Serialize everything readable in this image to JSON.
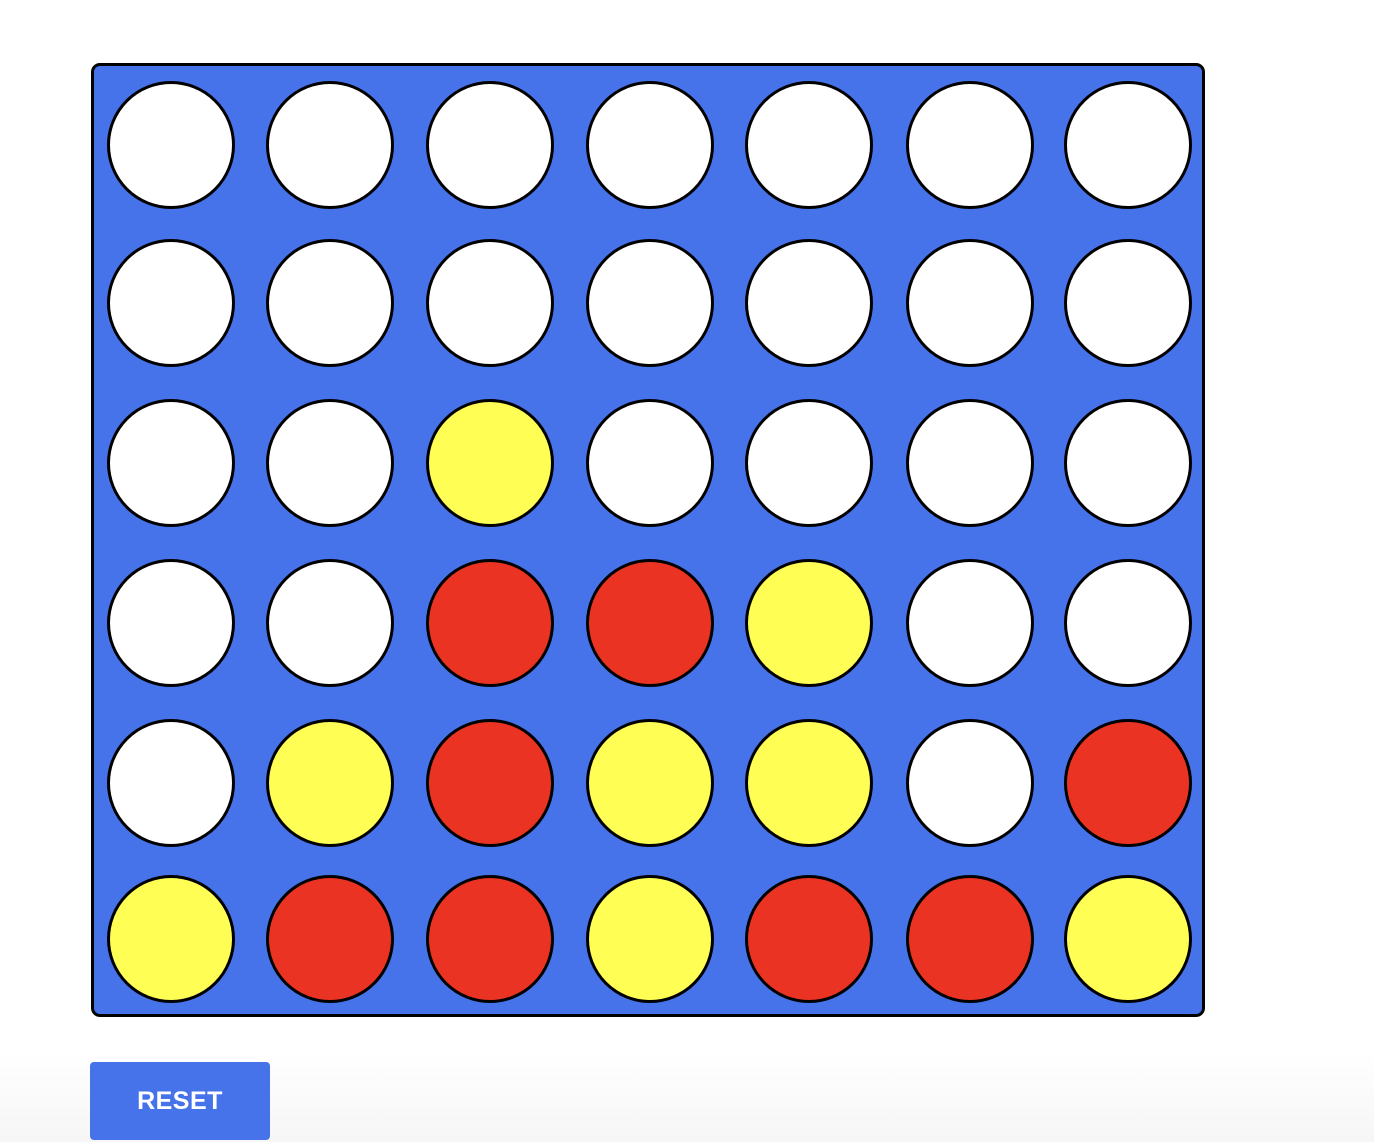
{
  "colors": {
    "board": "#4673ea",
    "empty": "#ffffff",
    "red": "#ea3323",
    "yellow": "#fefe54",
    "outline": "#000000"
  },
  "board": {
    "rows": 6,
    "cols": 7,
    "cells": [
      [
        "empty",
        "empty",
        "empty",
        "empty",
        "empty",
        "empty",
        "empty"
      ],
      [
        "empty",
        "empty",
        "empty",
        "empty",
        "empty",
        "empty",
        "empty"
      ],
      [
        "empty",
        "empty",
        "yellow",
        "empty",
        "empty",
        "empty",
        "empty"
      ],
      [
        "empty",
        "empty",
        "red",
        "red",
        "yellow",
        "empty",
        "empty"
      ],
      [
        "empty",
        "yellow",
        "red",
        "yellow",
        "yellow",
        "empty",
        "red"
      ],
      [
        "yellow",
        "red",
        "red",
        "yellow",
        "red",
        "red",
        "yellow"
      ]
    ]
  },
  "controls": {
    "reset_label": "RESET"
  }
}
